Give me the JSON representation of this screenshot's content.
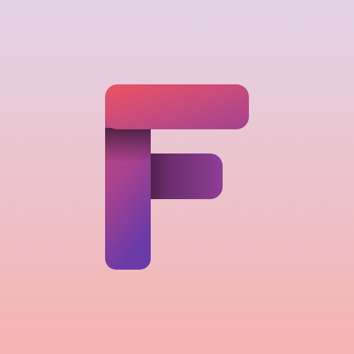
{
  "icon": {
    "name": "letter-f-logo-icon",
    "logo_lettering": "F",
    "colors": {
      "background_top": "#e3d3e8",
      "background_bottom": "#f5b3b1",
      "letter_gradient_start": "#ec5362",
      "letter_gradient_mid": "#c04a82",
      "letter_gradient_end": "#6a3aa6",
      "crossbar_shadow": "#3c1c3b"
    }
  }
}
